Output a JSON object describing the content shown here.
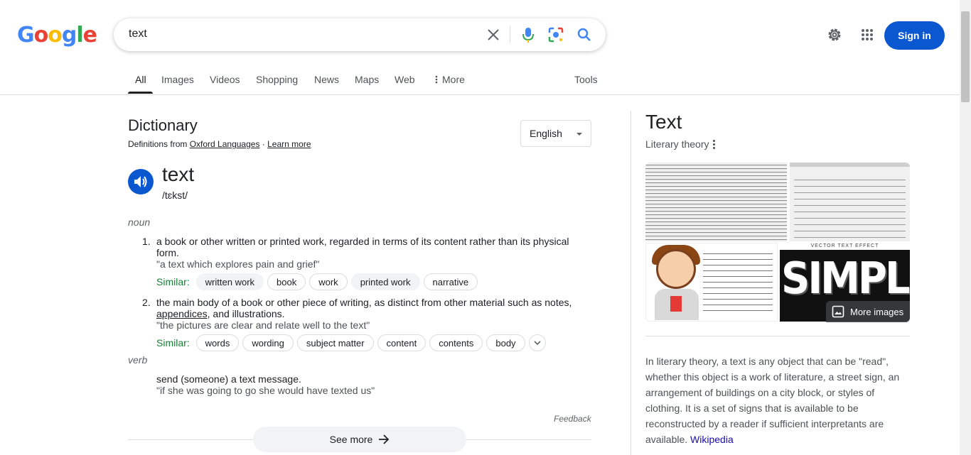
{
  "header": {
    "logo_letters": [
      {
        "ch": "G",
        "color": "#4285f4"
      },
      {
        "ch": "o",
        "color": "#ea4335"
      },
      {
        "ch": "o",
        "color": "#fbbc05"
      },
      {
        "ch": "g",
        "color": "#4285f4"
      },
      {
        "ch": "l",
        "color": "#34a853"
      },
      {
        "ch": "e",
        "color": "#ea4335"
      }
    ],
    "query": "text",
    "signin_label": "Sign in",
    "icons": [
      "clear-icon",
      "mic-icon",
      "lens-icon",
      "search-icon",
      "gear-icon",
      "apps-icon"
    ]
  },
  "tabs": [
    {
      "label": "All"
    },
    {
      "label": "Images"
    },
    {
      "label": "Videos"
    },
    {
      "label": "Shopping"
    },
    {
      "label": "News"
    },
    {
      "label": "Maps"
    },
    {
      "label": "Web"
    },
    {
      "label": "More"
    }
  ],
  "tools_label": "Tools",
  "dictionary": {
    "title": "Dictionary",
    "src_prefix": "Definitions from ",
    "src_link": "Oxford Languages",
    "src_sep": " · ",
    "learn_more": "Learn more",
    "language": "English",
    "word": "text",
    "phonetic": "/tɛkst/",
    "noun_label": "noun",
    "verb_label": "verb",
    "definitions": [
      {
        "num": "1.",
        "text": "a book or other written or printed work, regarded in terms of its content rather than its physical form.",
        "example": "\"a text which explores pain and grief\"",
        "similar_label": "Similar:",
        "similar": [
          "written work",
          "book",
          "work",
          "printed work",
          "narrative"
        ]
      },
      {
        "num": "2.",
        "text_before": "the main body of a book or other piece of writing, as distinct from other material such as notes, ",
        "text_link": "appendices",
        "text_after": ", and illustrations.",
        "example": "\"the pictures are clear and relate well to the text\"",
        "similar_label": "Similar:",
        "similar": [
          "words",
          "wording",
          "subject matter",
          "content",
          "contents",
          "body"
        ]
      }
    ],
    "verb_definition": {
      "text": "send (someone) a text message.",
      "example": "\"if she was going to go she would have texted us\""
    },
    "feedback": "Feedback",
    "see_more": "See more"
  },
  "knowledge_panel": {
    "title": "Text",
    "subtitle": "Literary theory",
    "image_text": {
      "vector_header": "VECTOR TEXT EFFECT",
      "simple": "SIMPLE"
    },
    "more_images": "More images",
    "description": "In literary theory, a text is any object that can be \"read\", whether this object is a work of literature, a street sign, an arrangement of buildings on a city block, or styles of clothing. It is a set of signs that is available to be reconstructed by a reader if sufficient interpretants are available. ",
    "source": "Wikipedia"
  },
  "colors": {
    "brand_blue": "#0b57d0",
    "similar_green": "#188038",
    "link_blue": "#1a0dab"
  }
}
